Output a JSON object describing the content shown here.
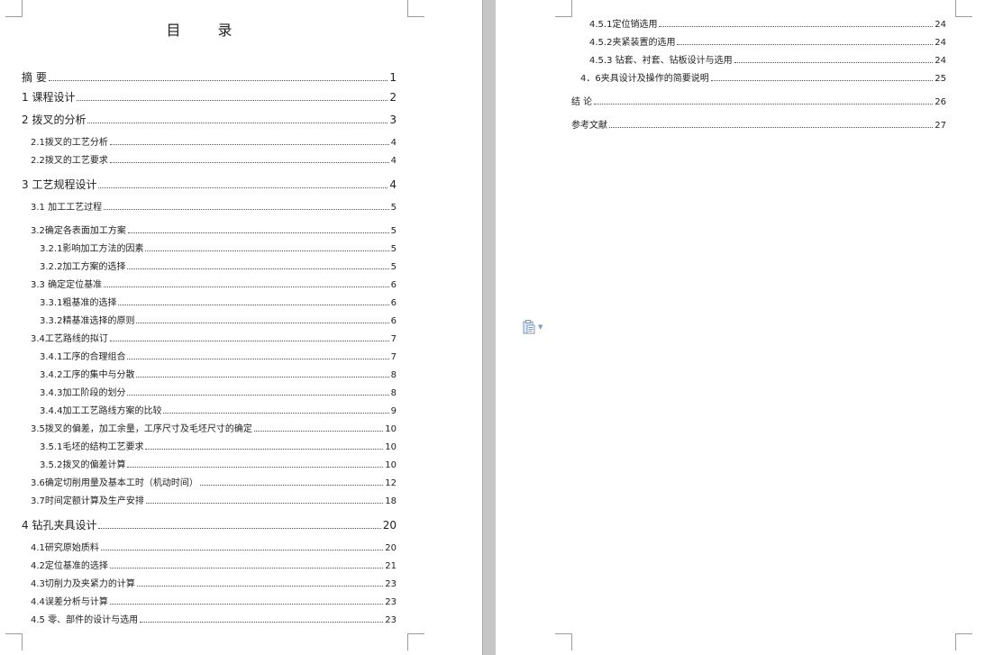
{
  "toc_title": "目  录",
  "left_entries": [
    {
      "label": "摘    要",
      "page": "1"
    },
    {
      "label": "1    课程设计",
      "page": "2"
    },
    {
      "label": "2    拨叉的分析",
      "page": "3"
    },
    {
      "label": "2.1拨叉的工艺分析",
      "page": "4"
    },
    {
      "label": "2.2拨叉的工艺要求",
      "page": "4"
    },
    {
      "label": "3    工艺规程设计",
      "page": "4"
    },
    {
      "label": "3.1  加工工艺过程",
      "page": "5"
    },
    {
      "label": "3.2确定各表面加工方案",
      "page": "5"
    },
    {
      "label": "3.2.1影响加工方法的因素",
      "page": "5"
    },
    {
      "label": "3.2.2加工方案的选择",
      "page": "5"
    },
    {
      "label": "3.3  确定定位基准",
      "page": "6"
    },
    {
      "label": "3.3.1粗基准的选择",
      "page": "6"
    },
    {
      "label": "3.3.2精基准选择的原则",
      "page": "6"
    },
    {
      "label": "3.4工艺路线的拟订",
      "page": "7"
    },
    {
      "label": "3.4.1工序的合理组合",
      "page": "7"
    },
    {
      "label": "3.4.2工序的集中与分散",
      "page": "8"
    },
    {
      "label": "3.4.3加工阶段的划分",
      "page": "8"
    },
    {
      "label": "3.4.4加工工艺路线方案的比较",
      "page": "9"
    },
    {
      "label": "3.5拨叉的偏差，加工余量，工序尺寸及毛坯尺寸的确定",
      "page": "10"
    },
    {
      "label": "3.5.1毛坯的结构工艺要求",
      "page": "10"
    },
    {
      "label": "3.5.2拨叉的偏差计算",
      "page": "10"
    },
    {
      "label": "3.6确定切削用量及基本工时（机动时间）",
      "page": "12"
    },
    {
      "label": "3.7时间定额计算及生产安排",
      "page": "18"
    },
    {
      "label": "4 钻孔夹具设计",
      "page": "20"
    },
    {
      "label": "4.1研究原始质料",
      "page": "20"
    },
    {
      "label": "4.2定位基准的选择",
      "page": "21"
    },
    {
      "label": "4.3切削力及夹紧力的计算",
      "page": "23"
    },
    {
      "label": "4.4误差分析与计算",
      "page": "23"
    },
    {
      "label": "4.5  零、部件的设计与选用",
      "page": "23"
    }
  ],
  "right_entries": [
    {
      "label": "4.5.1定位销选用",
      "page": "24"
    },
    {
      "label": "4.5.2夹紧装置的选用",
      "page": "24"
    },
    {
      "label": "4.5.3  钻套、衬套、钻板设计与选用",
      "page": "24"
    },
    {
      "label": "4．6夹具设计及操作的简要说明",
      "page": "25"
    },
    {
      "label": "结    论",
      "page": "26"
    },
    {
      "label": "参考文献",
      "page": "27"
    }
  ],
  "icons": {
    "paste": "paste-options-icon",
    "dropdown": "chevron-down-icon"
  }
}
